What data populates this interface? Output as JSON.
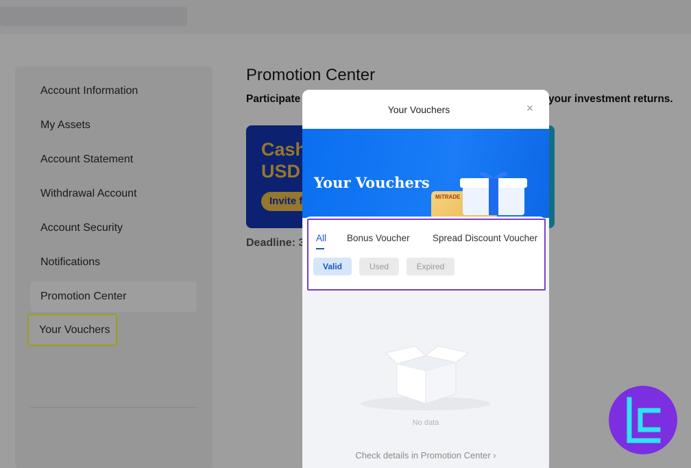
{
  "page": {
    "title": "Promotion Center",
    "subtitle_left": "Participate",
    "subtitle_right": "your investment returns.",
    "promo_card": {
      "line1": "Cash",
      "line2": "USD",
      "button": "Invite f"
    },
    "deadline": "Deadline: 3"
  },
  "sidebar": {
    "items": [
      {
        "label": "Account Information"
      },
      {
        "label": "My Assets"
      },
      {
        "label": "Account Statement"
      },
      {
        "label": "Withdrawal Account"
      },
      {
        "label": "Account Security"
      },
      {
        "label": "Notifications"
      },
      {
        "label": "Promotion Center"
      },
      {
        "label": "Your Vouchers"
      }
    ]
  },
  "modal": {
    "title": "Your Vouchers",
    "close_icon": "×",
    "banner_title": "Your Vouchers",
    "card_brand": "MiTRADE",
    "tabs": [
      {
        "label": "All"
      },
      {
        "label": "Bonus Voucher"
      },
      {
        "label": "Spread Discount Voucher"
      }
    ],
    "filters": [
      {
        "label": "Valid"
      },
      {
        "label": "Used"
      },
      {
        "label": "Expired"
      }
    ],
    "empty_text": "No data",
    "details_link": "Check details in Promotion Center ›"
  },
  "colors": {
    "highlight_yellow": "#ffff2e",
    "tabs_outline_purple": "#7a3bc8",
    "accent_blue": "#1457c8",
    "banner_blue": "#0a6ff0",
    "logo_purple": "#7b2fe0",
    "logo_cyan": "#2fe3f0"
  },
  "icons": {
    "close": "close-icon",
    "gift": "gift-box-icon",
    "empty_box": "empty-box-icon",
    "brand_logo": "brand-logo-icon"
  }
}
